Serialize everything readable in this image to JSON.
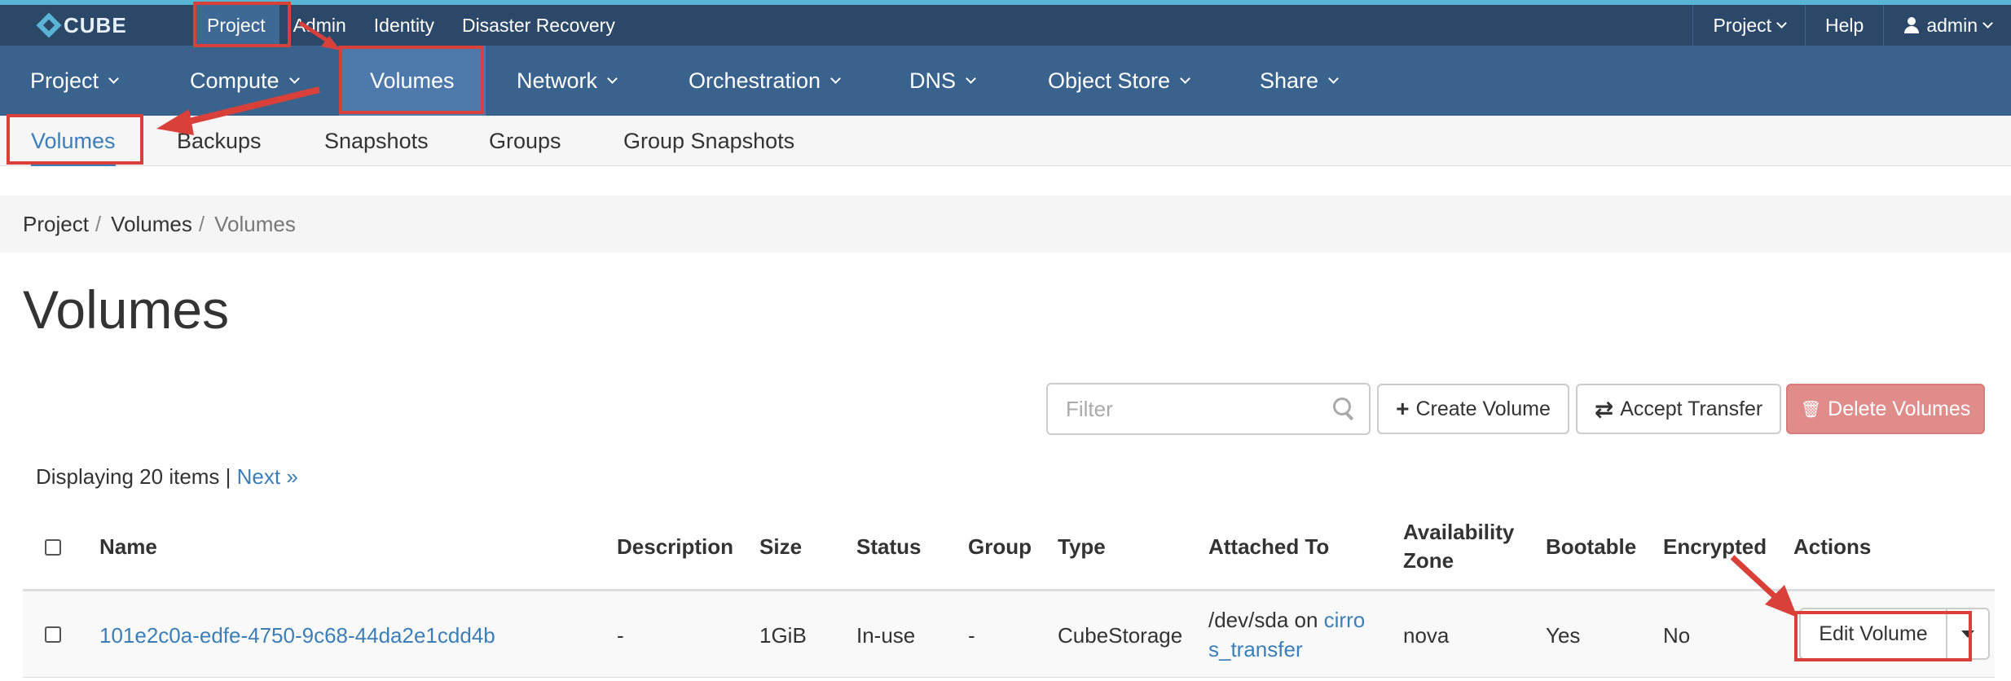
{
  "brand": {
    "name": "CUBE",
    "accent_color": "#5ab4d6",
    "bar_color": "#2b4868"
  },
  "top_nav": {
    "items": [
      {
        "label": "Project",
        "active": true
      },
      {
        "label": "Admin",
        "active": false
      },
      {
        "label": "Identity",
        "active": false
      },
      {
        "label": "Disaster Recovery",
        "active": false
      }
    ]
  },
  "top_right": {
    "project_menu": "Project",
    "help": "Help",
    "user": "admin"
  },
  "main_nav": {
    "items": [
      {
        "label": "Project",
        "icon": "chevron-down-icon"
      },
      {
        "label": "Compute",
        "icon": "chevron-down-icon"
      },
      {
        "label": "Volumes",
        "active": true
      },
      {
        "label": "Network",
        "icon": "chevron-down-icon"
      },
      {
        "label": "Orchestration",
        "icon": "chevron-down-icon"
      },
      {
        "label": "DNS",
        "icon": "chevron-down-icon"
      },
      {
        "label": "Object Store",
        "icon": "chevron-down-icon"
      },
      {
        "label": "Share",
        "icon": "chevron-down-icon"
      }
    ]
  },
  "sub_nav": {
    "tabs": [
      {
        "label": "Volumes",
        "active": true
      },
      {
        "label": "Backups"
      },
      {
        "label": "Snapshots"
      },
      {
        "label": "Groups"
      },
      {
        "label": "Group Snapshots"
      }
    ]
  },
  "breadcrumb": {
    "items": [
      "Project",
      "Volumes",
      "Volumes"
    ],
    "separator": "/"
  },
  "page": {
    "title": "Volumes"
  },
  "toolbar": {
    "filter_placeholder": "Filter",
    "create_volume": "Create Volume",
    "accept_transfer": "Accept Transfer",
    "delete_volumes": "Delete Volumes",
    "plus_glyph": "+",
    "transfer_glyph": "⇄",
    "trash_glyph": "🗑"
  },
  "listing": {
    "displaying_text": "Displaying 20 items |",
    "next_link": "Next »"
  },
  "table": {
    "columns": {
      "name": "Name",
      "description": "Description",
      "size": "Size",
      "status": "Status",
      "group": "Group",
      "type": "Type",
      "attached_to": "Attached To",
      "availability_zone": "Availability Zone",
      "bootable": "Bootable",
      "encrypted": "Encrypted",
      "actions": "Actions"
    },
    "rows": [
      {
        "name": "101e2c0a-edfe-4750-9c68-44da2e1cdd4b",
        "description": "-",
        "size": "1GiB",
        "status": "In-use",
        "group": "-",
        "type": "CubeStorage",
        "attached_prefix": "/dev/sda on ",
        "attached_link": "cirros_transfer",
        "availability_zone": "nova",
        "bootable": "Yes",
        "encrypted": "No",
        "action": "Edit Volume"
      }
    ]
  },
  "colors": {
    "annotation": "#d9403a",
    "link": "#3c7fb8",
    "danger": "#e08c8a"
  }
}
